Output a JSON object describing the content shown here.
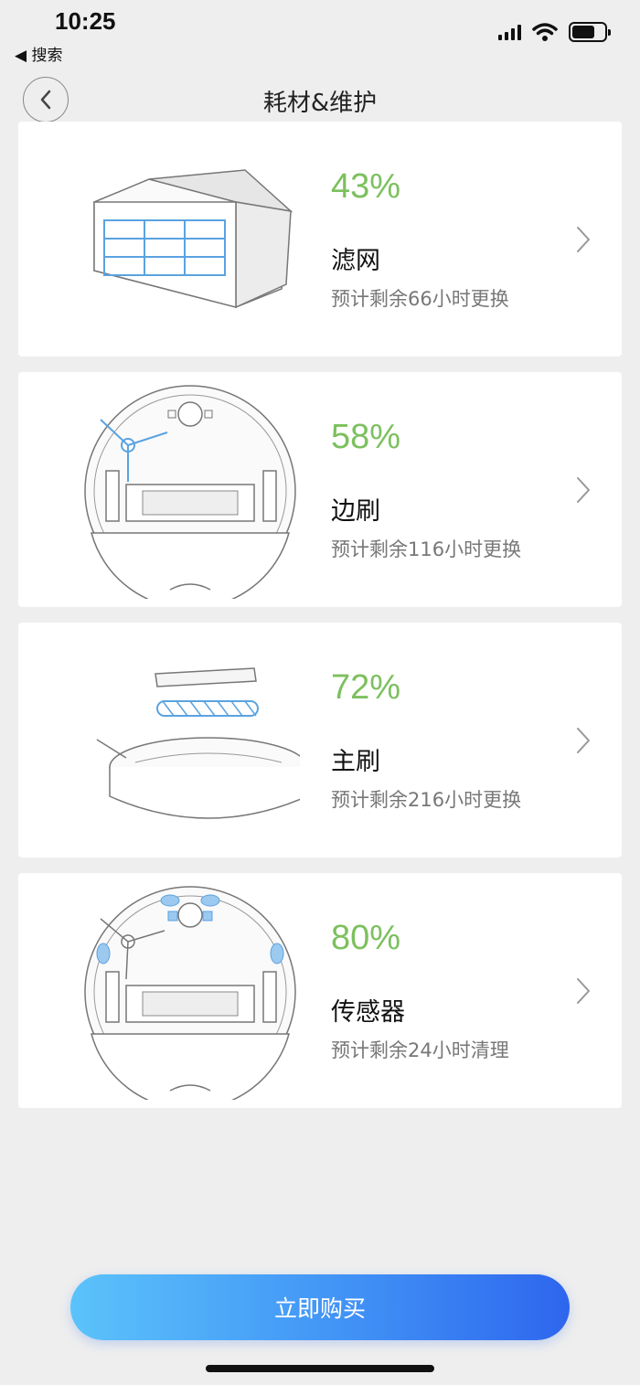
{
  "status_bar": {
    "time": "10:25",
    "back_app": "◀ 搜索",
    "icons": [
      "signal-icon",
      "wifi-icon",
      "battery-icon"
    ]
  },
  "nav": {
    "title": "耗材&维护",
    "back_icon": "chevron-left-icon"
  },
  "accent_color": "#7cc05e",
  "items": [
    {
      "percent": "43%",
      "name": "滤网",
      "desc": "预计剩余66小时更换",
      "icon": "filter-icon"
    },
    {
      "percent": "58%",
      "name": "边刷",
      "desc": "预计剩余116小时更换",
      "icon": "side-brush-icon"
    },
    {
      "percent": "72%",
      "name": "主刷",
      "desc": "预计剩余216小时更换",
      "icon": "main-brush-icon"
    },
    {
      "percent": "80%",
      "name": "传感器",
      "desc": "预计剩余24小时清理",
      "icon": "sensor-icon"
    }
  ],
  "buy_button": {
    "label": "立即购买"
  }
}
